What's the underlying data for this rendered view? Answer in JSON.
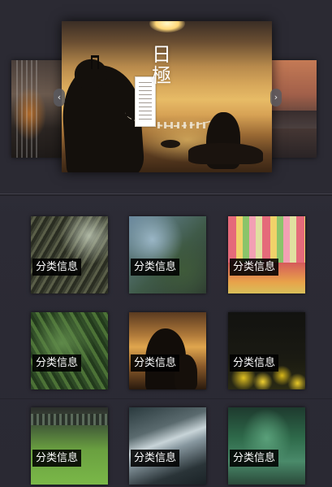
{
  "carousel": {
    "title": "日極",
    "nav_prev_icon": "chevron-left-icon",
    "nav_next_icon": "chevron-right-icon"
  },
  "grid": {
    "items": [
      {
        "label": "分类信息"
      },
      {
        "label": "分类信息"
      },
      {
        "label": "分类信息"
      },
      {
        "label": "分类信息"
      },
      {
        "label": "分类信息"
      },
      {
        "label": "分类信息"
      },
      {
        "label": "分类信息"
      },
      {
        "label": "分类信息"
      },
      {
        "label": "分类信息"
      }
    ]
  },
  "colors": {
    "background": "#2e2d37",
    "label_background": "#000000",
    "label_text": "#ffffff"
  }
}
